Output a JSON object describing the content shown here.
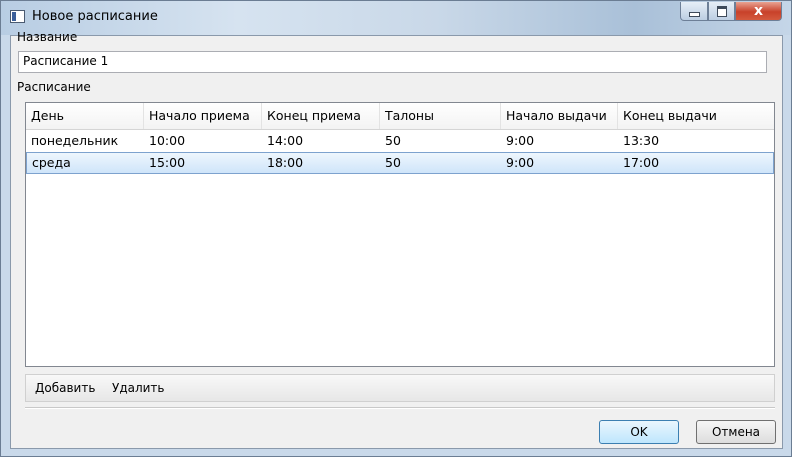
{
  "window": {
    "title": "Новое расписание",
    "close_glyph": "x"
  },
  "form": {
    "name_label": "Название",
    "name_value": "Расписание 1",
    "schedule_label": "Расписание"
  },
  "table": {
    "columns": [
      "День",
      "Начало приема",
      "Конец приема",
      "Талоны",
      "Начало выдачи",
      "Конец выдачи"
    ],
    "rows": [
      [
        "понедельник",
        "10:00",
        "14:00",
        "50",
        "9:00",
        "13:30"
      ],
      [
        "среда",
        "15:00",
        "18:00",
        "50",
        "9:00",
        "17:00"
      ]
    ],
    "selected_row": 1
  },
  "toolbar": {
    "add_label": "Добавить",
    "delete_label": "Удалить"
  },
  "buttons": {
    "ok_label": "OK",
    "cancel_label": "Отмена"
  },
  "colors": {
    "selection_border": "#7da2ce",
    "close_button": "#c8412a",
    "ok_border": "#3c7fb1"
  }
}
